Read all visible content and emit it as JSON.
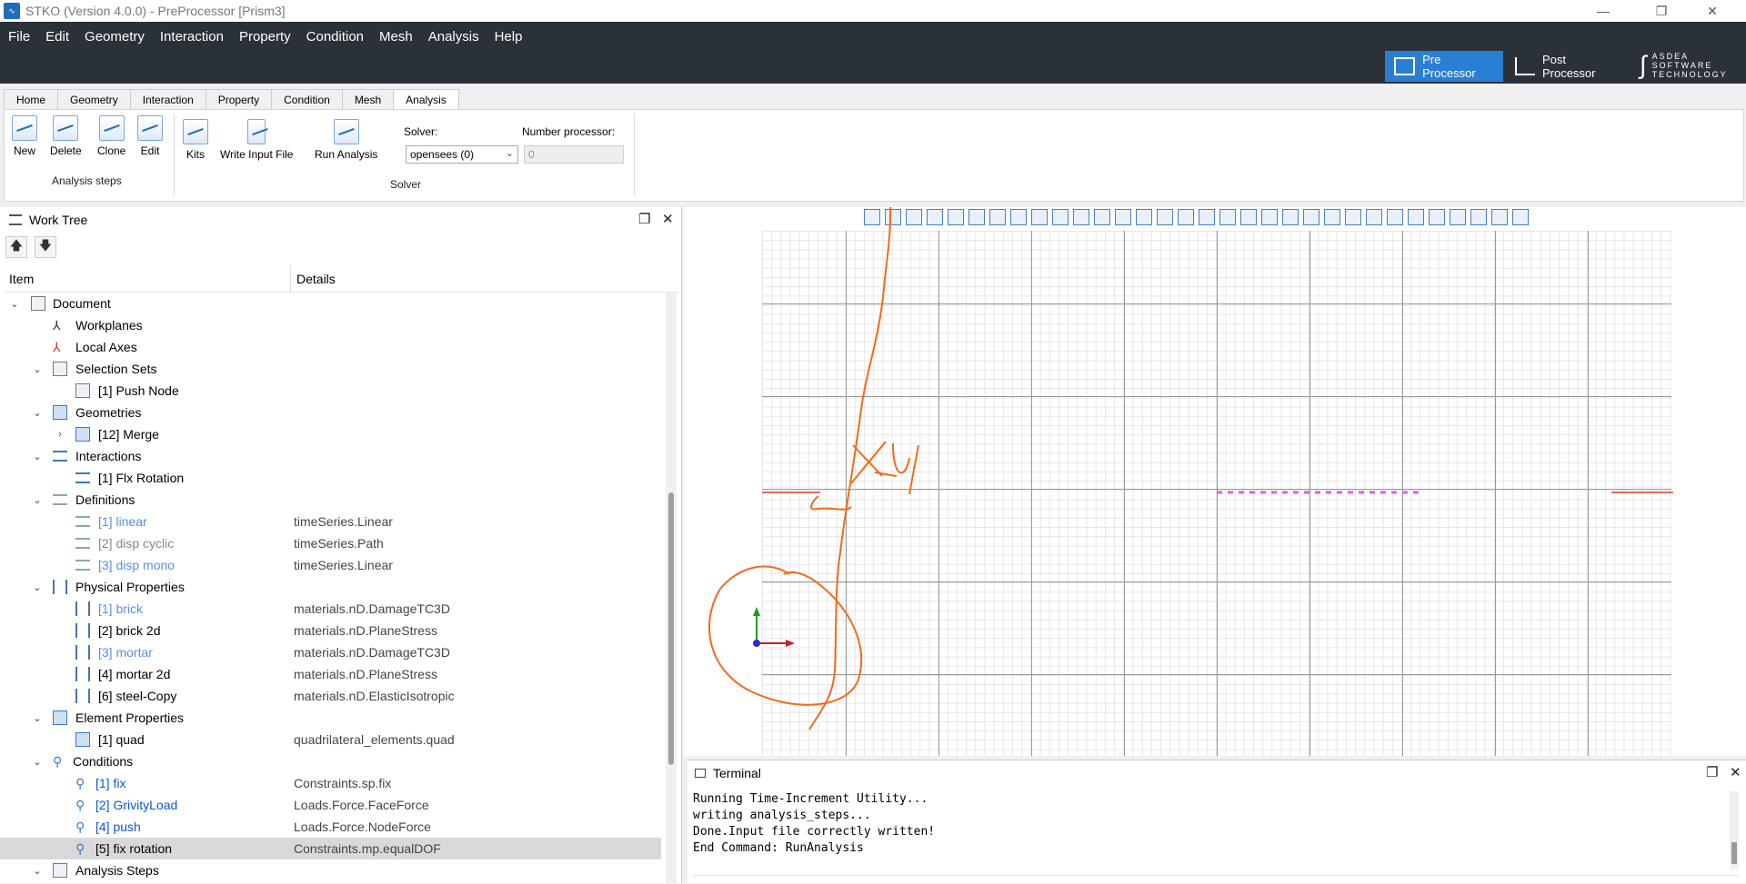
{
  "window": {
    "title": "STKO (Version 4.0.0) - PreProcessor [Prism3]",
    "minimize": "—",
    "restore": "❐",
    "close": "✕"
  },
  "menu": [
    "File",
    "Edit",
    "Geometry",
    "Interaction",
    "Property",
    "Condition",
    "Mesh",
    "Analysis",
    "Help"
  ],
  "modes": {
    "pre": "Pre Processor",
    "post": "Post Processor"
  },
  "logo": {
    "line1": "ASDEA",
    "line2": "SOFTWARE",
    "line3": "TECHNOLOGY"
  },
  "ribbon_tabs": [
    "Home",
    "Geometry",
    "Interaction",
    "Property",
    "Condition",
    "Mesh",
    "Analysis"
  ],
  "ribbon": {
    "steps": {
      "new": "New",
      "delete": "Delete",
      "clone": "Clone",
      "edit": "Edit",
      "group": "Analysis steps"
    },
    "kits": "Kits",
    "write_input": "Write Input File",
    "run": "Run Analysis",
    "solver_label": "Solver:",
    "solver_value": "opensees (0)",
    "nproc_label": "Number processor:",
    "nproc_value": "0",
    "solver_group": "Solver"
  },
  "worktree": {
    "title": "Work Tree",
    "col_item": "Item",
    "col_details": "Details",
    "rows": [
      {
        "label": "Document",
        "detail": ""
      },
      {
        "label": "Workplanes",
        "detail": ""
      },
      {
        "label": "Local Axes",
        "detail": ""
      },
      {
        "label": "Selection Sets",
        "detail": ""
      },
      {
        "label": "[1] Push Node",
        "detail": ""
      },
      {
        "label": "Geometries",
        "detail": ""
      },
      {
        "label": "[12] Merge",
        "detail": ""
      },
      {
        "label": "Interactions",
        "detail": ""
      },
      {
        "label": "[1] Flx Rotation",
        "detail": ""
      },
      {
        "label": "Definitions",
        "detail": ""
      },
      {
        "label": "[1] linear",
        "detail": "timeSeries.Linear"
      },
      {
        "label": "[2] disp cyclic",
        "detail": "timeSeries.Path"
      },
      {
        "label": "[3] disp mono",
        "detail": "timeSeries.Linear"
      },
      {
        "label": "Physical Properties",
        "detail": ""
      },
      {
        "label": "[1] brick",
        "detail": "materials.nD.DamageTC3D"
      },
      {
        "label": "[2] brick 2d",
        "detail": "materials.nD.PlaneStress"
      },
      {
        "label": "[3] mortar",
        "detail": "materials.nD.DamageTC3D"
      },
      {
        "label": "[4] mortar 2d",
        "detail": "materials.nD.PlaneStress"
      },
      {
        "label": "[6] steel-Copy",
        "detail": "materials.nD.ElasticIsotropic"
      },
      {
        "label": "Element Properties",
        "detail": ""
      },
      {
        "label": "[1] quad",
        "detail": "quadrilateral_elements.quad"
      },
      {
        "label": "Conditions",
        "detail": ""
      },
      {
        "label": "[1] fix",
        "detail": "Constraints.sp.fix"
      },
      {
        "label": "[2] GrivityLoad",
        "detail": "Loads.Force.FaceForce"
      },
      {
        "label": "[4] push",
        "detail": "Loads.Force.NodeForce"
      },
      {
        "label": "[5] fix rotation",
        "detail": "Constraints.mp.equalDOF"
      },
      {
        "label": "Analysis Steps",
        "detail": ""
      }
    ]
  },
  "viewport": {
    "annotation_text": "X-Y"
  },
  "terminal": {
    "title": "Terminal",
    "lines": [
      "Running Time-Increment Utility...",
      "writing analysis_steps...",
      "Done.Input file correctly written!",
      "End Command: RunAnalysis"
    ]
  }
}
